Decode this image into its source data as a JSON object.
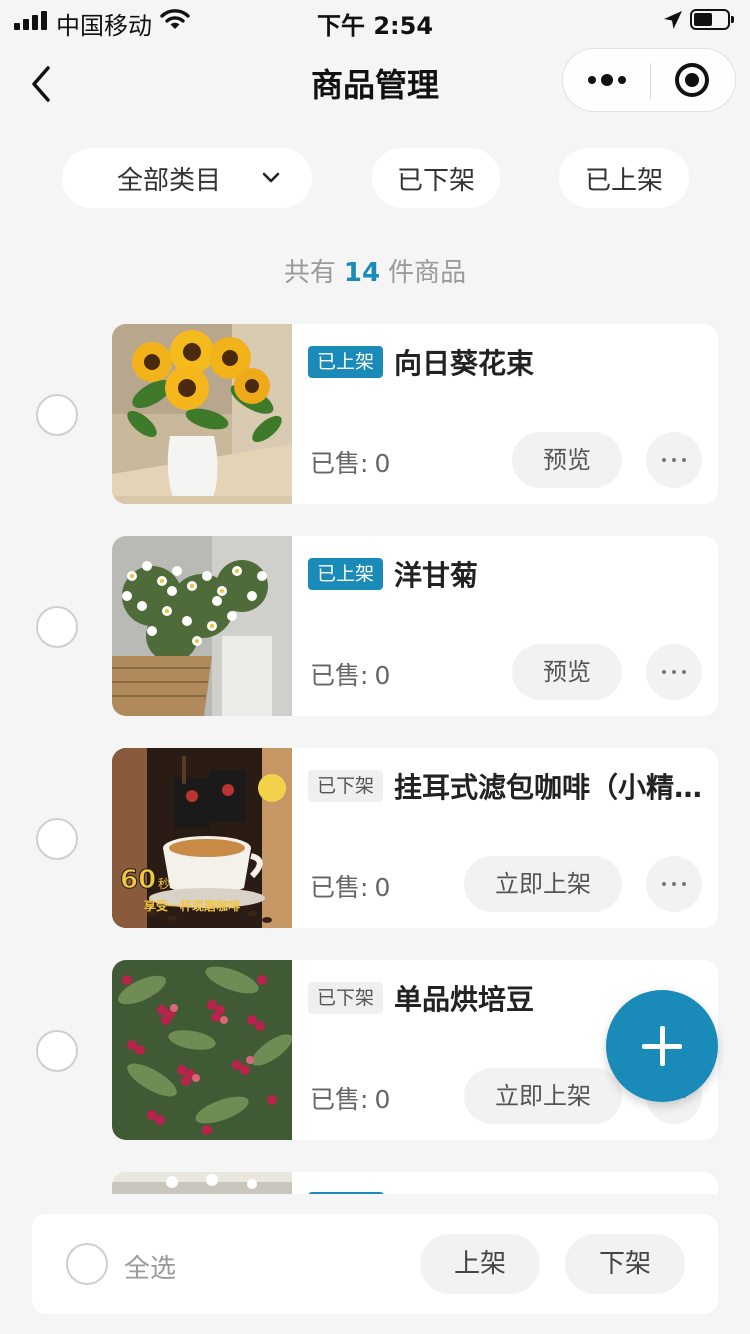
{
  "status_bar": {
    "carrier": "中国移动",
    "time": "下午 2:54",
    "icons": [
      "signal-icon",
      "wifi-icon",
      "location-icon",
      "battery-icon"
    ],
    "battery_level": 0.55
  },
  "nav": {
    "title": "商品管理",
    "icons": [
      "back-icon",
      "more-icon",
      "close-miniprogram-icon"
    ]
  },
  "filters": {
    "category": "全部类目",
    "off_shelf": "已下架",
    "on_shelf": "已上架"
  },
  "summary": {
    "prefix": "共有",
    "count": "14",
    "suffix": "件商品"
  },
  "products": [
    {
      "status": "已上架",
      "status_type": "on",
      "name": "向日葵花束",
      "sold_label": "已售:",
      "sold": "0",
      "action": "预览",
      "image": "sunflower-bouquet"
    },
    {
      "status": "已上架",
      "status_type": "on",
      "name": "洋甘菊",
      "sold_label": "已售:",
      "sold": "0",
      "action": "预览",
      "image": "chamomile-basket"
    },
    {
      "status": "已下架",
      "status_type": "off",
      "name": "挂耳式滤包咖啡（小精灵）",
      "sold_label": "已售:",
      "sold": "0",
      "action": "立即上架",
      "image": "drip-coffee"
    },
    {
      "status": "已下架",
      "status_type": "off",
      "name": "单品烘培豆",
      "sold_label": "已售:",
      "sold": "0",
      "action": "立即上架",
      "image": "coffee-cherries"
    }
  ],
  "coffee_thumb_text": {
    "big": "60",
    "small": "秒",
    "caption": "享受一杯现磨咖啡"
  },
  "bottom_bar": {
    "select_all": "全选",
    "on_shelf_btn": "上架",
    "off_shelf_btn": "下架"
  },
  "colors": {
    "accent": "#1a8ab8",
    "background": "#f5f5f5"
  }
}
